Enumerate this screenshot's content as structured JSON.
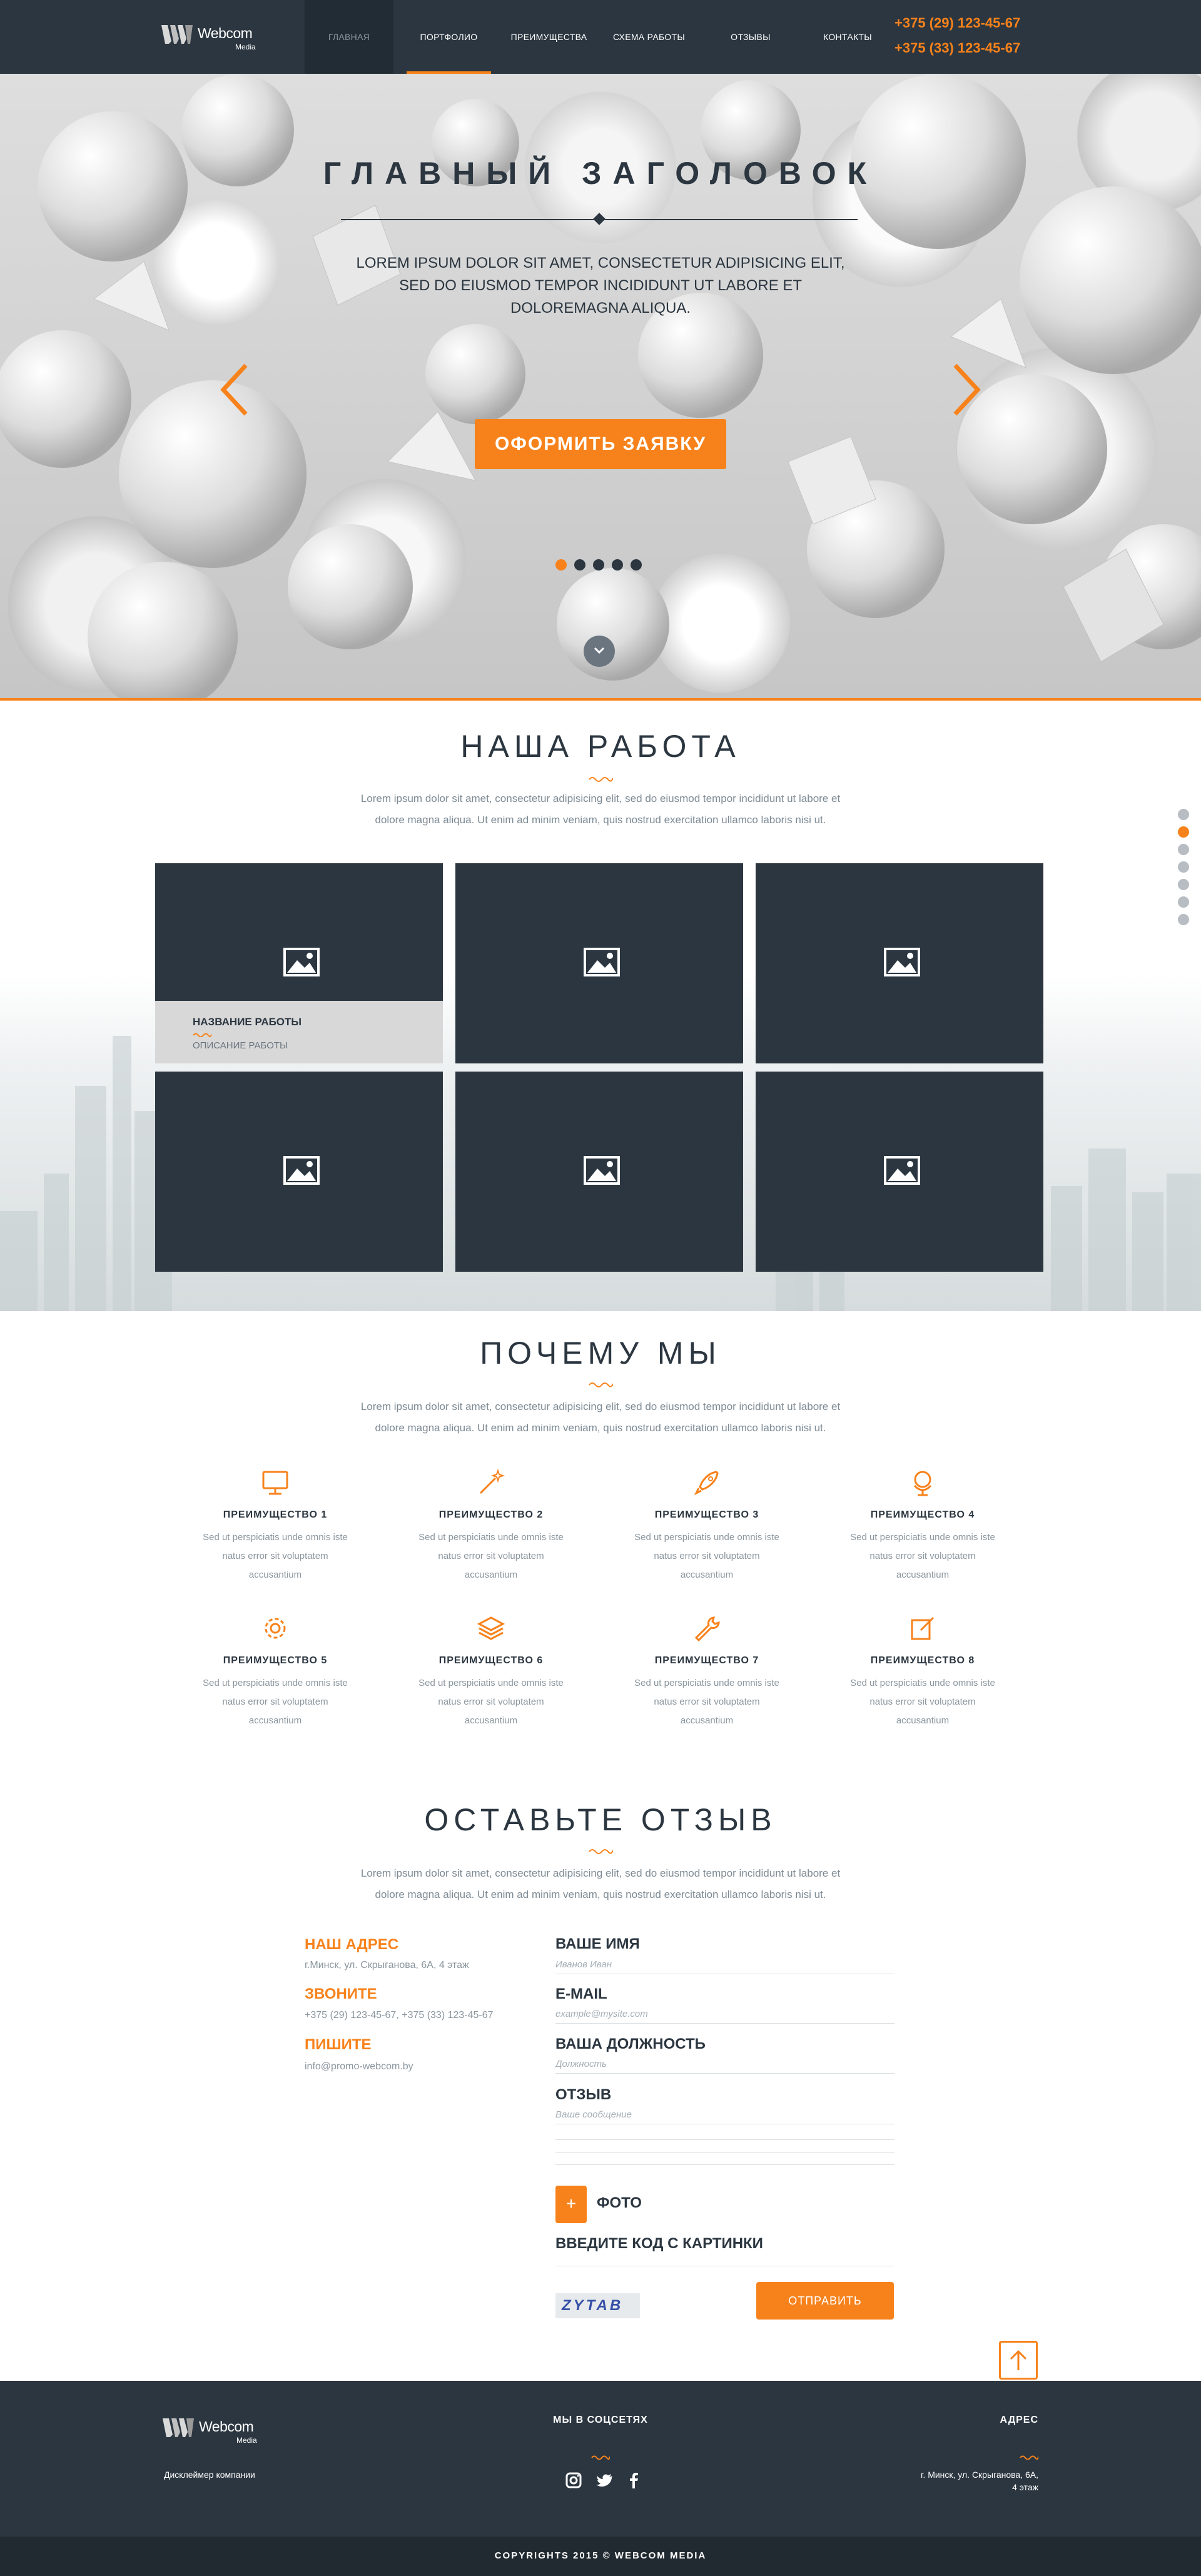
{
  "header": {
    "logo_name": "Webcom",
    "logo_sub": "Media",
    "nav": [
      "ГЛАВНАЯ",
      "ПОРТФОЛИО",
      "ПРЕИМУЩЕСТВА",
      "СХЕМА РАБОТЫ",
      "ОТЗЫВЫ",
      "КОНТАКТЫ"
    ],
    "active_nav": "ГЛАВНАЯ",
    "phones": [
      "+375 (29) 123-45-67",
      "+375 (33) 123-45-67"
    ]
  },
  "hero": {
    "title": "ГЛАВНЫЙ ЗАГОЛОВОК",
    "text": "LOREM IPSUM DOLOR SIT AMET, CONSECTETUR ADIPISICING ELIT, SED DO EIUSMOD TEMPOR INCIDIDUNT UT LABORE ET DOLOREMAGNA ALIQUA.",
    "cta": "ОФОРМИТЬ ЗАЯВКУ",
    "slides_total": 5,
    "slide_active": 1
  },
  "portfolio": {
    "title": "НАША РАБОТА",
    "text": "Lorem ipsum dolor sit amet, consectetur adipisicing elit, sed do eiusmod tempor incididunt ut labore et dolore magna aliqua. Ut enim ad minim veniam, quis nostrud exercitation ullamco laboris nisi ut.",
    "work_name": "НАЗВАНИЕ РАБОТЫ",
    "work_desc": "ОПИСАНИЕ РАБОТЫ",
    "sections_total": 7,
    "section_active": 2
  },
  "advantages": {
    "title": "ПОЧЕМУ МЫ",
    "text": "Lorem ipsum dolor sit amet, consectetur adipisicing elit, sed do eiusmod tempor incididunt ut labore et dolore magna aliqua. Ut enim ad minim veniam, quis nostrud exercitation ullamco laboris nisi ut.",
    "items": [
      {
        "name": "ПРЕИМУЩЕСТВО 1",
        "desc": "Sed ut perspiciatis unde omnis iste natus error sit voluptatem accusantium",
        "icon": "monitor-icon"
      },
      {
        "name": "ПРЕИМУЩЕСТВО 2",
        "desc": "Sed ut perspiciatis unde omnis iste natus error sit voluptatem accusantium",
        "icon": "magic-wand-icon"
      },
      {
        "name": "ПРЕИМУЩЕСТВО 3",
        "desc": "Sed ut perspiciatis unde omnis iste natus error sit voluptatem accusantium",
        "icon": "rocket-icon"
      },
      {
        "name": "ПРЕИМУЩЕСТВО 4",
        "desc": "Sed ut perspiciatis unde omnis iste natus error sit voluptatem accusantium",
        "icon": "globe-icon"
      },
      {
        "name": "ПРЕИМУЩЕСТВО 5",
        "desc": "Sed ut perspiciatis unde omnis iste natus error sit voluptatem accusantium",
        "icon": "gear-icon"
      },
      {
        "name": "ПРЕИМУЩЕСТВО 6",
        "desc": "Sed ut perspiciatis unde omnis iste natus error sit voluptatem accusantium",
        "icon": "layers-icon"
      },
      {
        "name": "ПРЕИМУЩЕСТВО 7",
        "desc": "Sed ut perspiciatis unde omnis iste natus error sit voluptatem accusantium",
        "icon": "wrench-icon"
      },
      {
        "name": "ПРЕИМУЩЕСТВО 8",
        "desc": "Sed ut perspiciatis unde omnis iste natus error sit voluptatem accusantium",
        "icon": "edit-icon"
      }
    ]
  },
  "feedback": {
    "title": "ОСТАВЬТЕ ОТЗЫВ",
    "text": "Lorem ipsum dolor sit amet, consectetur adipisicing elit, sed do eiusmod tempor incididunt ut labore et dolore magna aliqua. Ut enim ad minim veniam, quis nostrud exercitation ullamco laboris nisi ut.",
    "address_h": "НАШ АДРЕС",
    "address_t": "г.Минск, ул. Скрыганова, 6А, 4 этаж",
    "call_h": "ЗВОНИТЕ",
    "call_t": "+375 (29) 123-45-67, +375 (33) 123-45-67",
    "write_h": "ПИШИТЕ",
    "write_t": "info@promo-webcom.by",
    "name_label": "ВАШЕ ИМЯ",
    "name_ph": "Иванов Иван",
    "email_label": "E-MAIL",
    "email_ph": "example@mysite.com",
    "position_label": "ВАША ДОЛЖНОСТЬ",
    "position_ph": "Должность",
    "review_label": "ОТЗЫВ",
    "review_ph": "Ваше сообщение",
    "photo_plus": "+",
    "photo_label": "ФОТО",
    "captcha_label": "ВВЕДИТЕ КОД С КАРТИНКИ",
    "captcha_code": "ZYTAB",
    "submit": "ОТПРАВИТЬ"
  },
  "footer": {
    "logo_name": "Webcom",
    "logo_sub": "Media",
    "disclaimer": "Дисклеймер компании",
    "social_h": "МЫ В СОЦСЕТЯХ",
    "address_h": "АДРЕС",
    "address_1": "г. Минск, ул. Скрыганова, 6А,",
    "address_2": "4 этаж",
    "copyright": "COPYRIGHTS 2015 © WEBCOM MEDIA"
  },
  "colors": {
    "accent": "#f7821b",
    "dark": "#2b3640",
    "muted": "#8b969e"
  }
}
